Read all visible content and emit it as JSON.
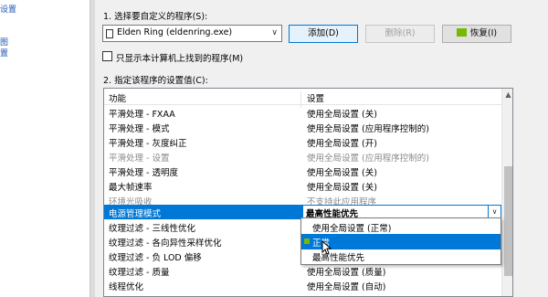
{
  "left_links": [
    "设置",
    "图",
    "置"
  ],
  "step1": {
    "label": "1. 选择要自定义的程序(S):"
  },
  "program": {
    "selected": "Elden Ring (eldenring.exe)"
  },
  "buttons": {
    "add": "添加(D)",
    "delete": "删除(R)",
    "restore": "恢复(I)"
  },
  "checkbox": {
    "label": "只显示本计算机上找到的程序(M)",
    "checked": false
  },
  "step2": {
    "label": "2. 指定该程序的设置值(C):"
  },
  "grid": {
    "headers": {
      "feature": "功能",
      "setting": "设置"
    },
    "rows": [
      {
        "feature": "平滑处理 - FXAA",
        "setting": "使用全局设置 (关)",
        "grey": false
      },
      {
        "feature": "平滑处理 - 模式",
        "setting": "使用全局设置 (应用程序控制的)",
        "grey": false
      },
      {
        "feature": "平滑处理 - 灰度纠正",
        "setting": "使用全局设置 (开)",
        "grey": false
      },
      {
        "feature": "平滑处理 - 设置",
        "setting": "使用全局设置 (应用程序控制的)",
        "grey": true
      },
      {
        "feature": "平滑处理 - 透明度",
        "setting": "使用全局设置 (关)",
        "grey": false
      },
      {
        "feature": "最大帧速率",
        "setting": "使用全局设置 (关)",
        "grey": false
      },
      {
        "feature": "环境光吸收",
        "setting": "不支持此应用程序",
        "grey": true
      },
      {
        "feature": "电源管理模式",
        "setting": "",
        "grey": false
      },
      {
        "feature": "纹理过滤 - 三线性优化",
        "setting": "",
        "grey": false
      },
      {
        "feature": "纹理过滤 - 各向异性采样优化",
        "setting": "",
        "grey": false
      },
      {
        "feature": "纹理过滤 - 负 LOD 偏移",
        "setting": "",
        "grey": false
      },
      {
        "feature": "纹理过滤 - 质量",
        "setting": "使用全局设置 (质量)",
        "grey": false
      },
      {
        "feature": "线程优化",
        "setting": "使用全局设置 (自动)",
        "grey": false
      }
    ],
    "selected_cell_value": "最高性能优先",
    "popup_options": [
      "使用全局设置 (正常)",
      "正常",
      "最高性能优先"
    ],
    "highlighted_option": "正常"
  },
  "colors": {
    "selection": "#0078d7",
    "nvidia_green": "#76b900",
    "link": "#1f57b5"
  }
}
